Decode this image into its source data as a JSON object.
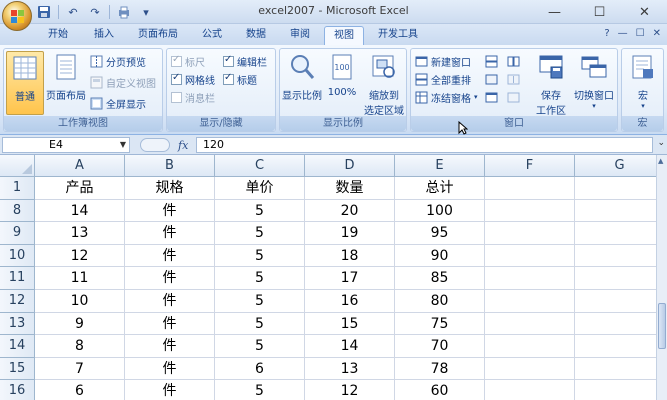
{
  "window": {
    "title": "excel2007 - Microsoft Excel",
    "minimize": "—",
    "maximize": "☐",
    "close": "✕"
  },
  "qat": {
    "save": "💾",
    "undo": "↶",
    "redo": "↷",
    "more": "▾"
  },
  "tabs": [
    {
      "label": "开始"
    },
    {
      "label": "插入"
    },
    {
      "label": "页面布局"
    },
    {
      "label": "公式"
    },
    {
      "label": "数据"
    },
    {
      "label": "审阅"
    },
    {
      "label": "视图"
    },
    {
      "label": "开发工具"
    }
  ],
  "tab_right": {
    "help": "?",
    "min": "—",
    "restore": "☐",
    "close": "✕"
  },
  "ribbon": {
    "workbook_views": {
      "label": "工作簿视图",
      "normal": "普通",
      "page_layout": "页面布局",
      "page_break": "分页预览",
      "custom_views": "自定义视图",
      "full_screen": "全屏显示"
    },
    "show_hide": {
      "label": "显示/隐藏",
      "ruler": "标尺",
      "gridlines": "网格线",
      "message_bar": "消息栏",
      "formula_bar": "编辑栏",
      "headings": "标题"
    },
    "zoom": {
      "label": "显示比例",
      "zoom": "显示比例",
      "hundred": "100%",
      "zoom_selection_1": "缩放到",
      "zoom_selection_2": "选定区域"
    },
    "window": {
      "label": "窗口",
      "new_window": "新建窗口",
      "arrange_all": "全部重排",
      "freeze_panes": "冻结窗格",
      "save_workspace_1": "保存",
      "save_workspace_2": "工作区",
      "switch_windows": "切换窗口"
    },
    "macros": {
      "label": "宏",
      "macros": "宏"
    }
  },
  "formula_bar": {
    "name_box": "E4",
    "fx": "fx",
    "value": "120"
  },
  "grid": {
    "columns": [
      "A",
      "B",
      "C",
      "D",
      "E",
      "F",
      "G"
    ],
    "rows": [
      {
        "num": "1",
        "cells": [
          "产品",
          "规格",
          "单价",
          "数量",
          "总计",
          "",
          ""
        ]
      },
      {
        "num": "8",
        "cells": [
          "14",
          "件",
          "5",
          "20",
          "100",
          "",
          ""
        ]
      },
      {
        "num": "9",
        "cells": [
          "13",
          "件",
          "5",
          "19",
          "95",
          "",
          ""
        ]
      },
      {
        "num": "10",
        "cells": [
          "12",
          "件",
          "5",
          "18",
          "90",
          "",
          ""
        ]
      },
      {
        "num": "11",
        "cells": [
          "11",
          "件",
          "5",
          "17",
          "85",
          "",
          ""
        ]
      },
      {
        "num": "12",
        "cells": [
          "10",
          "件",
          "5",
          "16",
          "80",
          "",
          ""
        ]
      },
      {
        "num": "13",
        "cells": [
          "9",
          "件",
          "5",
          "15",
          "75",
          "",
          ""
        ]
      },
      {
        "num": "14",
        "cells": [
          "8",
          "件",
          "5",
          "14",
          "70",
          "",
          ""
        ]
      },
      {
        "num": "15",
        "cells": [
          "7",
          "件",
          "6",
          "13",
          "78",
          "",
          ""
        ]
      },
      {
        "num": "16",
        "cells": [
          "6",
          "件",
          "5",
          "12",
          "60",
          "",
          ""
        ]
      }
    ]
  },
  "colors": {
    "ribbon_bg": "#dfeaf8",
    "active_button": "#ffc44c",
    "header_bg": "#dde8f5",
    "text_blue": "#15428b"
  }
}
